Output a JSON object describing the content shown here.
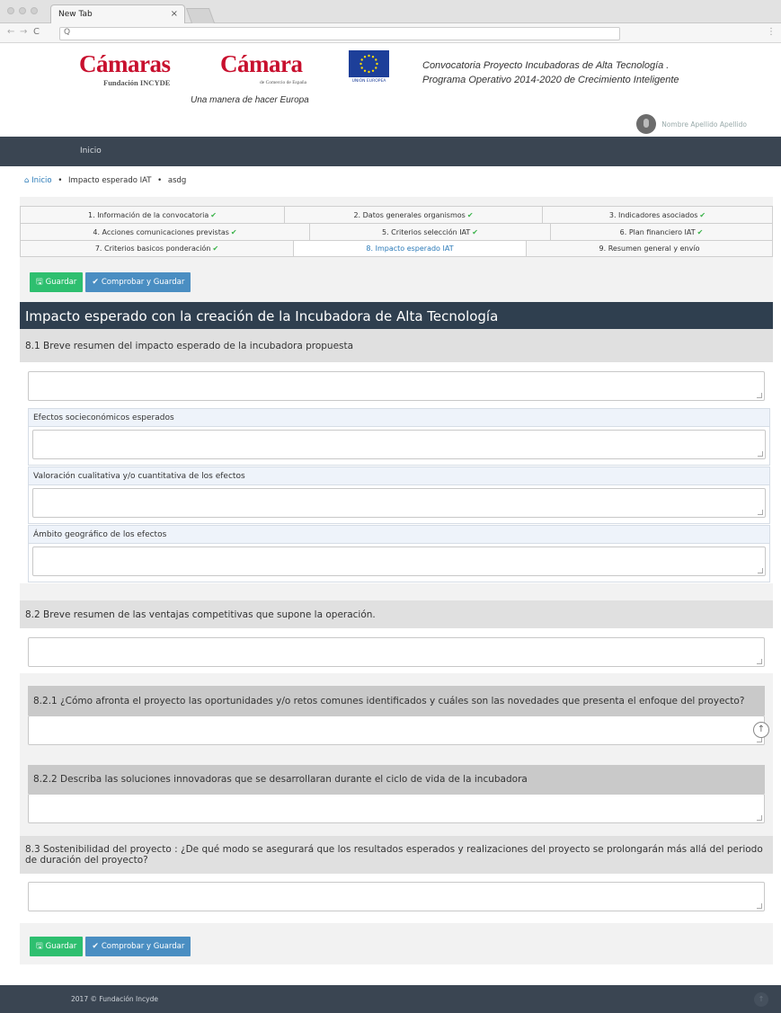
{
  "browser": {
    "tab_title": "New Tab",
    "tab_close": "×",
    "url_placeholder": "",
    "url_icon": "search-icon",
    "back_glyph": "←",
    "forward_glyph": "→",
    "reload_glyph": "C",
    "search_glyph": "Q",
    "menu_glyph": "⋮"
  },
  "header": {
    "logo1_text": "Cámaras",
    "logo1_sub": "Fundación INCYDE",
    "logo2_text": "Cámara",
    "logo2_sub": "de Comercio de España",
    "eu_label": "UNIÓN EUROPEA",
    "tagline": "Una manera de hacer Europa",
    "conv_line1": "Convocatoria Proyecto Incubadoras de Alta Tecnología .",
    "conv_line2": "Programa Operativo 2014-2020 de Crecimiento Inteligente",
    "user_name": "Nombre Apellido Apellido"
  },
  "nav": {
    "home": "Inicio"
  },
  "breadcrumb": {
    "home": "Inicio",
    "current": "Impacto esperado IAT",
    "leaf": "asdg",
    "sep": "•"
  },
  "steps": {
    "row1": [
      {
        "label": "1. Información de la convocatoria",
        "done": "✔"
      },
      {
        "label": "2. Datos generales organismos",
        "done": "✔"
      },
      {
        "label": "3. Indicadores asociados",
        "done": "✔"
      }
    ],
    "row2": [
      {
        "label": "4. Acciones comunicaciones previstas",
        "done": "✔"
      },
      {
        "label": "5. Criterios selección IAT",
        "done": "✔"
      },
      {
        "label": "6. Plan financiero IAT",
        "done": "✔"
      }
    ],
    "row3": [
      {
        "label": "7. Criterios basicos ponderación",
        "done": "✔"
      },
      {
        "label": "8. Impacto esperado IAT",
        "done": ""
      },
      {
        "label": "9. Resumen general y envío",
        "done": ""
      }
    ]
  },
  "buttons": {
    "save": "Guardar",
    "save_icon": "💾",
    "check_save": "Comprobar y Guardar",
    "check_icon": "✔"
  },
  "section": {
    "title": "Impacto esperado con la creación de la Incubadora de Alta Tecnología",
    "s81": "8.1 Breve resumen del impacto esperado de la incubadora propuesta",
    "effects": "Efectos socieconómicos esperados",
    "valuation": "Valoración cualitativa y/o cuantitativa de los efectos",
    "scope": "Ámbito geográfico de los efectos",
    "s82": "8.2 Breve resumen de las ventajas competitivas que supone la operación.",
    "s821": "8.2.1 ¿Cómo afronta el proyecto las oportunidades y/o retos comunes identificados y cuáles son las novedades que presenta el enfoque del proyecto?",
    "s822": "8.2.2 Describa las soluciones innovadoras que se desarrollaran durante el ciclo de vida de la incubadora",
    "s83": "8.3 Sostenibilidad del proyecto : ¿De qué modo se asegurará que los resultados esperados y realizaciones del proyecto se prolongarán más allá del periodo de duración del proyecto?"
  },
  "scroll_up_glyph": "↑",
  "footer": {
    "text": "2017 © Fundación Incyde",
    "up_glyph": "↑"
  },
  "colors": {
    "nav_bg": "#3a4552",
    "title_bg": "#2f3f4f",
    "save_green": "#2ebf6f",
    "check_blue": "#4a8ec2",
    "brand_red": "#c8102e",
    "step_done": "#3bb34a",
    "link_blue": "#2a7ab8"
  }
}
